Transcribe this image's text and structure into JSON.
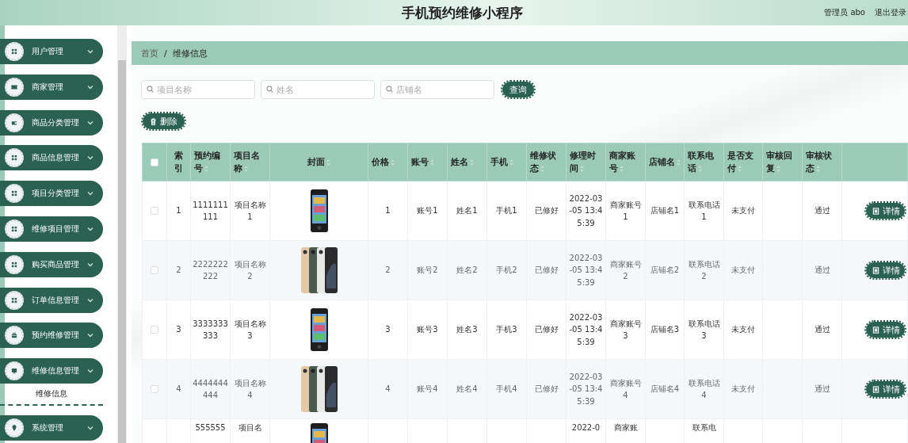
{
  "header": {
    "title": "手机预约维修小程序",
    "user": "管理员 abo",
    "logout": "退出登录"
  },
  "sidebar": {
    "items": [
      {
        "label": "用户管理"
      },
      {
        "label": "商家管理"
      },
      {
        "label": "商品分类管理"
      },
      {
        "label": "商品信息管理"
      },
      {
        "label": "项目分类管理"
      },
      {
        "label": "维修项目管理"
      },
      {
        "label": "购买商品管理"
      },
      {
        "label": "订单信息管理"
      },
      {
        "label": "预约维修管理"
      },
      {
        "label": "维修信息管理",
        "children": [
          {
            "label": "维修信息"
          }
        ]
      },
      {
        "label": "系统管理"
      }
    ]
  },
  "breadcrumb": {
    "items": [
      "首页",
      "维修信息"
    ],
    "separator": "/"
  },
  "search": {
    "fields": [
      {
        "placeholder": "项目名称"
      },
      {
        "placeholder": "姓名"
      },
      {
        "placeholder": "店铺名"
      }
    ],
    "button": "查询"
  },
  "toolbar": {
    "delete_button": "删除"
  },
  "table": {
    "select_all_checked": false,
    "columns": [
      {
        "label": "索引",
        "sortable": false
      },
      {
        "label": "预约编号",
        "sortable": true
      },
      {
        "label": "项目名称",
        "sortable": true
      },
      {
        "label": "封面",
        "sortable": true
      },
      {
        "label": "价格",
        "sortable": true
      },
      {
        "label": "账号",
        "sortable": true
      },
      {
        "label": "姓名",
        "sortable": true
      },
      {
        "label": "手机",
        "sortable": true
      },
      {
        "label": "维修状态",
        "sortable": true
      },
      {
        "label": "修理时间",
        "sortable": true
      },
      {
        "label": "商家账号",
        "sortable": true
      },
      {
        "label": "店铺名",
        "sortable": true
      },
      {
        "label": "联系电话",
        "sortable": true
      },
      {
        "label": "是否支付",
        "sortable": true
      },
      {
        "label": "审核回复",
        "sortable": true
      },
      {
        "label": "审核状态",
        "sortable": true
      }
    ],
    "rows": [
      {
        "checked": false,
        "index": "1",
        "booking_no": "1111111111",
        "item_name": "项目名称1",
        "price": "1",
        "account": "账号1",
        "name": "姓名1",
        "mobile": "手机1",
        "repair_status": "已修好",
        "repair_time": "2022-03-05 13:45:39",
        "merchant_account": "商家账号1",
        "shop_name": "店铺名1",
        "contact_phone": "联系电话1",
        "paid": "未支付",
        "audit_status": "通过",
        "action": "详情"
      },
      {
        "checked": false,
        "index": "2",
        "booking_no": "2222222222",
        "item_name": "项目名称2",
        "price": "2",
        "account": "账号2",
        "name": "姓名2",
        "mobile": "手机2",
        "repair_status": "已修好",
        "repair_time": "2022-03-05 13:45:39",
        "merchant_account": "商家账号2",
        "shop_name": "店铺名2",
        "contact_phone": "联系电话2",
        "paid": "未支付",
        "audit_status": "通过",
        "action": "详情"
      },
      {
        "checked": false,
        "index": "3",
        "booking_no": "3333333333",
        "item_name": "项目名称3",
        "price": "3",
        "account": "账号3",
        "name": "姓名3",
        "mobile": "手机3",
        "repair_status": "已修好",
        "repair_time": "2022-03-05 13:45:39",
        "merchant_account": "商家账号3",
        "shop_name": "店铺名3",
        "contact_phone": "联系电话3",
        "paid": "未支付",
        "audit_status": "通过",
        "action": "详情"
      },
      {
        "checked": false,
        "index": "4",
        "booking_no": "4444444444",
        "item_name": "项目名称4",
        "price": "4",
        "account": "账号4",
        "name": "姓名4",
        "mobile": "手机4",
        "repair_status": "已修好",
        "repair_time": "2022-03-05 13:45:39",
        "merchant_account": "商家账号4",
        "shop_name": "店铺名4",
        "contact_phone": "联系电话4",
        "paid": "未支付",
        "audit_status": "通过",
        "action": "详情"
      }
    ],
    "partial_row": {
      "booking_no": "555555",
      "item_name": "项目名",
      "repair_time": "2022-0",
      "merchant_account": "商家账",
      "contact_phone": "联系电"
    }
  }
}
